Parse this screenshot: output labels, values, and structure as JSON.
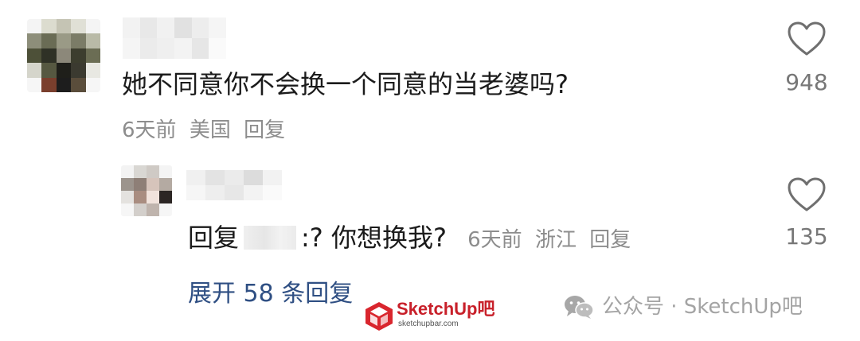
{
  "comments": [
    {
      "text": "她不同意你不会换一个同意的当老婆吗?",
      "time": "6天前",
      "location": "美国",
      "reply_label": "回复",
      "likes": "948"
    }
  ],
  "reply": {
    "prefix": "回复",
    "separator": ":",
    "text": "? 你想换我?",
    "time": "6天前",
    "location": "浙江",
    "reply_label": "回复",
    "likes": "135"
  },
  "expand_label": "展开 58 条回复",
  "watermark": {
    "text": "公众号 · SketchUp吧",
    "logo_text": "SketchUp吧",
    "logo_sub": "sketchupbar.com"
  },
  "icons": [
    "heart-outline-icon",
    "wechat-icon",
    "sketchup-logo-icon"
  ]
}
